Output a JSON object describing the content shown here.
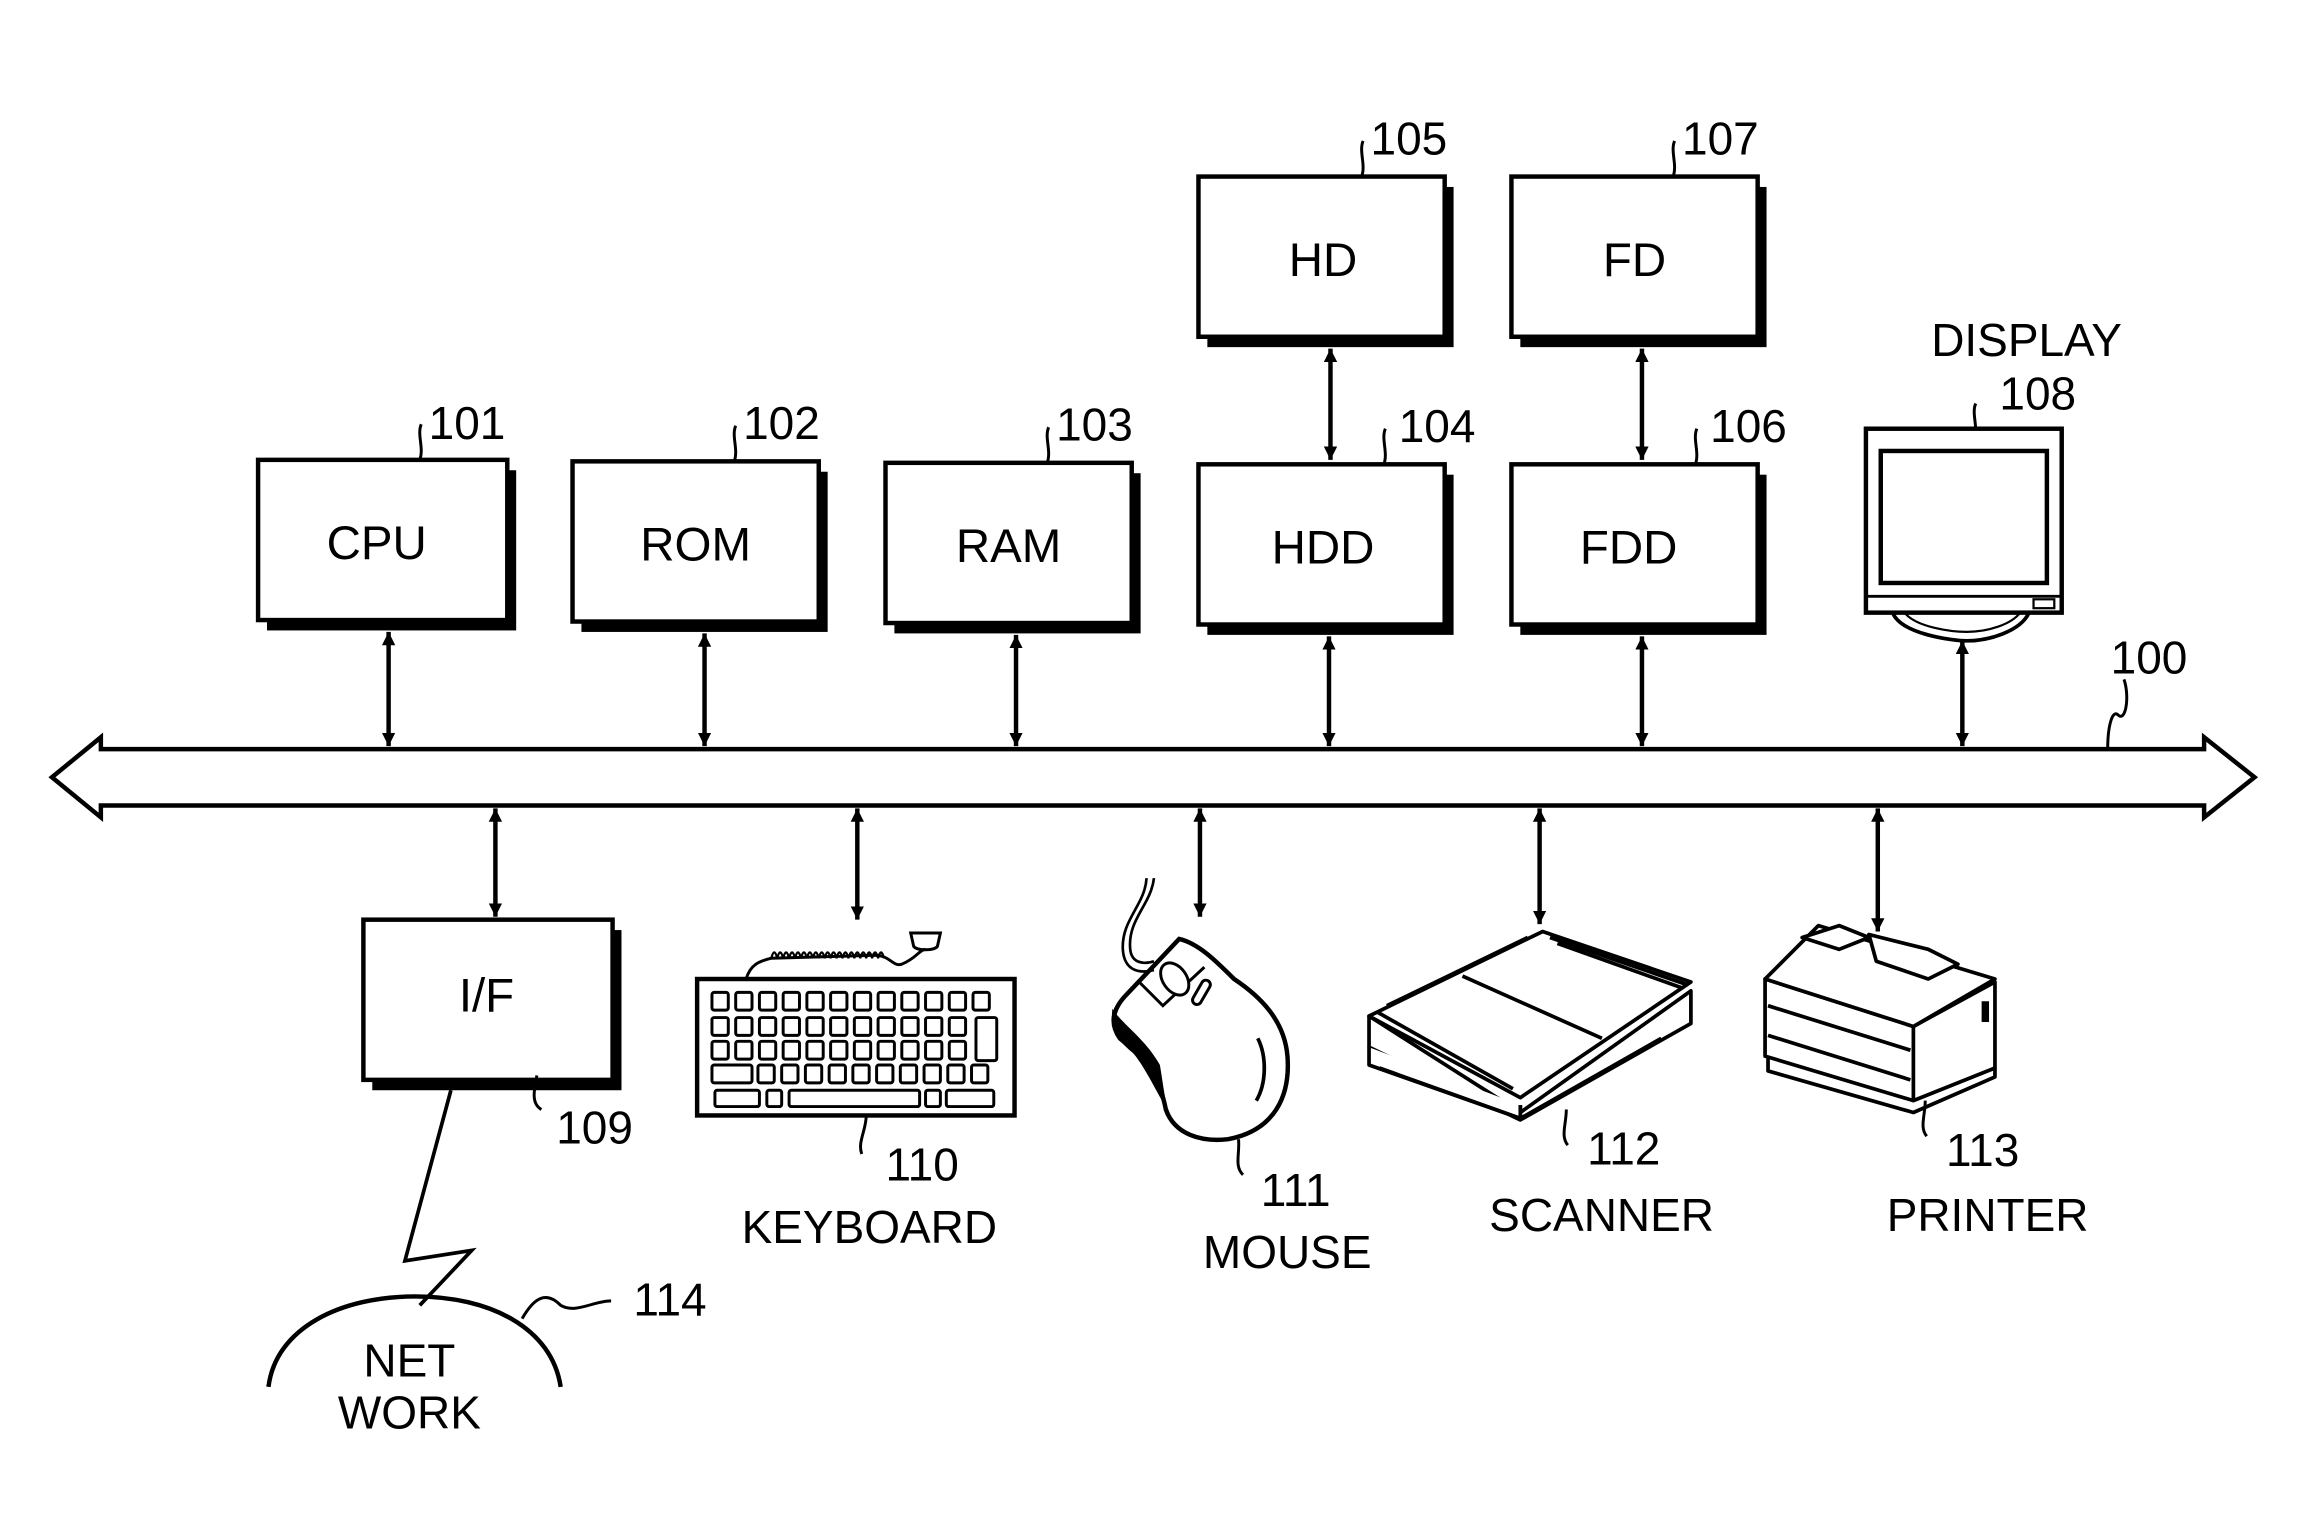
{
  "diagram": {
    "type": "block-diagram",
    "bus": {
      "ref": "100"
    },
    "blocks": [
      {
        "id": "cpu",
        "label": "CPU",
        "ref": "101"
      },
      {
        "id": "rom",
        "label": "ROM",
        "ref": "102"
      },
      {
        "id": "ram",
        "label": "RAM",
        "ref": "103"
      },
      {
        "id": "hdd",
        "label": "HDD",
        "ref": "104"
      },
      {
        "id": "hd",
        "label": "HD",
        "ref": "105"
      },
      {
        "id": "fdd",
        "label": "FDD",
        "ref": "106"
      },
      {
        "id": "fd",
        "label": "FD",
        "ref": "107"
      },
      {
        "id": "if",
        "label": "I/F",
        "ref": "109"
      }
    ],
    "devices": [
      {
        "id": "display",
        "label": "DISPLAY",
        "ref": "108"
      },
      {
        "id": "keyboard",
        "label": "KEYBOARD",
        "ref": "110"
      },
      {
        "id": "mouse",
        "label": "MOUSE",
        "ref": "111"
      },
      {
        "id": "scanner",
        "label": "SCANNER",
        "ref": "112"
      },
      {
        "id": "printer",
        "label": "PRINTER",
        "ref": "113"
      }
    ],
    "network": {
      "label_line1": "NET",
      "label_line2": "WORK",
      "ref": "114"
    },
    "connections": [
      [
        "cpu",
        "bus"
      ],
      [
        "rom",
        "bus"
      ],
      [
        "ram",
        "bus"
      ],
      [
        "hdd",
        "bus"
      ],
      [
        "fdd",
        "bus"
      ],
      [
        "display",
        "bus"
      ],
      [
        "hd",
        "hdd"
      ],
      [
        "fd",
        "fdd"
      ],
      [
        "if",
        "bus"
      ],
      [
        "keyboard",
        "bus"
      ],
      [
        "mouse",
        "bus"
      ],
      [
        "scanner",
        "bus"
      ],
      [
        "printer",
        "bus"
      ],
      [
        "if",
        "network"
      ]
    ]
  }
}
